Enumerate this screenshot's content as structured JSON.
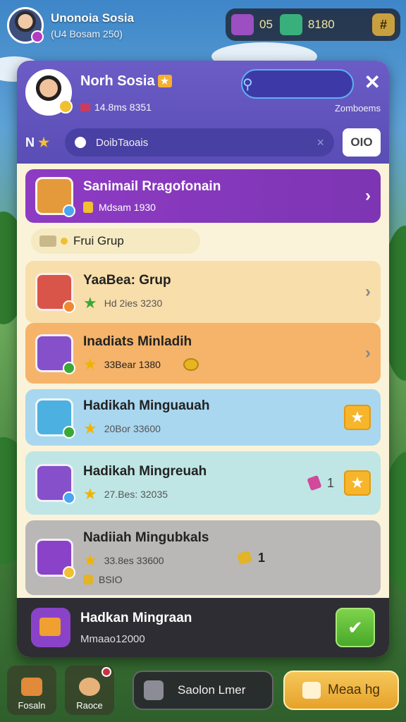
{
  "user": {
    "name": "Unonoia Sosia",
    "subtitle": "(U4 Bosam 250)"
  },
  "currency": [
    {
      "icon": "chest-icon",
      "value": "05",
      "color": "#9b4fc0"
    },
    {
      "icon": "gem-icon",
      "value": "8180",
      "color": "#39b07b"
    }
  ],
  "currency_button": "#",
  "panel": {
    "name": "Norh Sosia",
    "badge": "★",
    "subtitle": "14.8ms 8351",
    "search_placeholder": "",
    "close": "✕",
    "right_label": "Zomboems",
    "level_label": "N",
    "level_star": "★",
    "field_text": "DoibTaoais",
    "field_clear": "×",
    "box_value": "OIO"
  },
  "cards": [
    {
      "title": "Sanimail Rragofonain",
      "meta": "Mdsam 1930",
      "style": "c1"
    },
    {
      "group_label": "Frui Grup"
    },
    {
      "title": "YaaBea: Grup",
      "meta": "Hd 2ies 3230",
      "style": "c2",
      "star": "★",
      "star_color": "#3aa838"
    },
    {
      "title": "Inadiats Minladih",
      "meta": "33Bear 1380",
      "style": "c3",
      "star": "★"
    },
    {
      "title": "Hadikah Minguauah",
      "meta": "20Bor 33600",
      "style": "c4",
      "star": "★"
    },
    {
      "title": "Hadikah Mingreuah",
      "meta": "27.Bes: 32035",
      "style": "c5",
      "star": "★",
      "side_value": "1"
    },
    {
      "title": "Nadiiah Mingubkals",
      "meta": "33.8es 33600",
      "meta2": "BSIO",
      "style": "c6",
      "star": "★",
      "side_value": "1"
    }
  ],
  "footer": {
    "title": "Hadkan Mingraan",
    "meta": "Mmaao12000"
  },
  "nav": {
    "item1": "Fosaln",
    "item2": "Raoce",
    "wide": "Saolon Lmer",
    "primary": "Meaa hg"
  }
}
